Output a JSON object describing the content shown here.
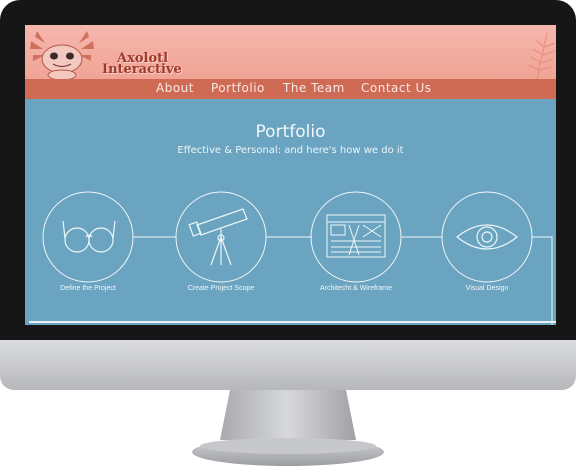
{
  "site": {
    "logo_line1": "Axolotl",
    "logo_line2": "Interactive"
  },
  "nav": {
    "items": [
      {
        "label": "About"
      },
      {
        "label": "Portfolio"
      },
      {
        "label": "The Team"
      },
      {
        "label": "Contact Us"
      }
    ]
  },
  "main": {
    "title": "Portfolio",
    "subtitle": "Effective & Personal: and here's how we do it"
  },
  "steps": [
    {
      "label": "Define the Project",
      "icon": "glasses-icon"
    },
    {
      "label": "Create Project Scope",
      "icon": "telescope-icon"
    },
    {
      "label": "Architecht & Wireframe",
      "icon": "wireframe-icon"
    },
    {
      "label": "Visual Design",
      "icon": "eye-icon"
    }
  ],
  "colors": {
    "header": "#f2aa9c",
    "nav": "#cf6a55",
    "body": "#6aa4c0",
    "bezel": "#161617"
  }
}
